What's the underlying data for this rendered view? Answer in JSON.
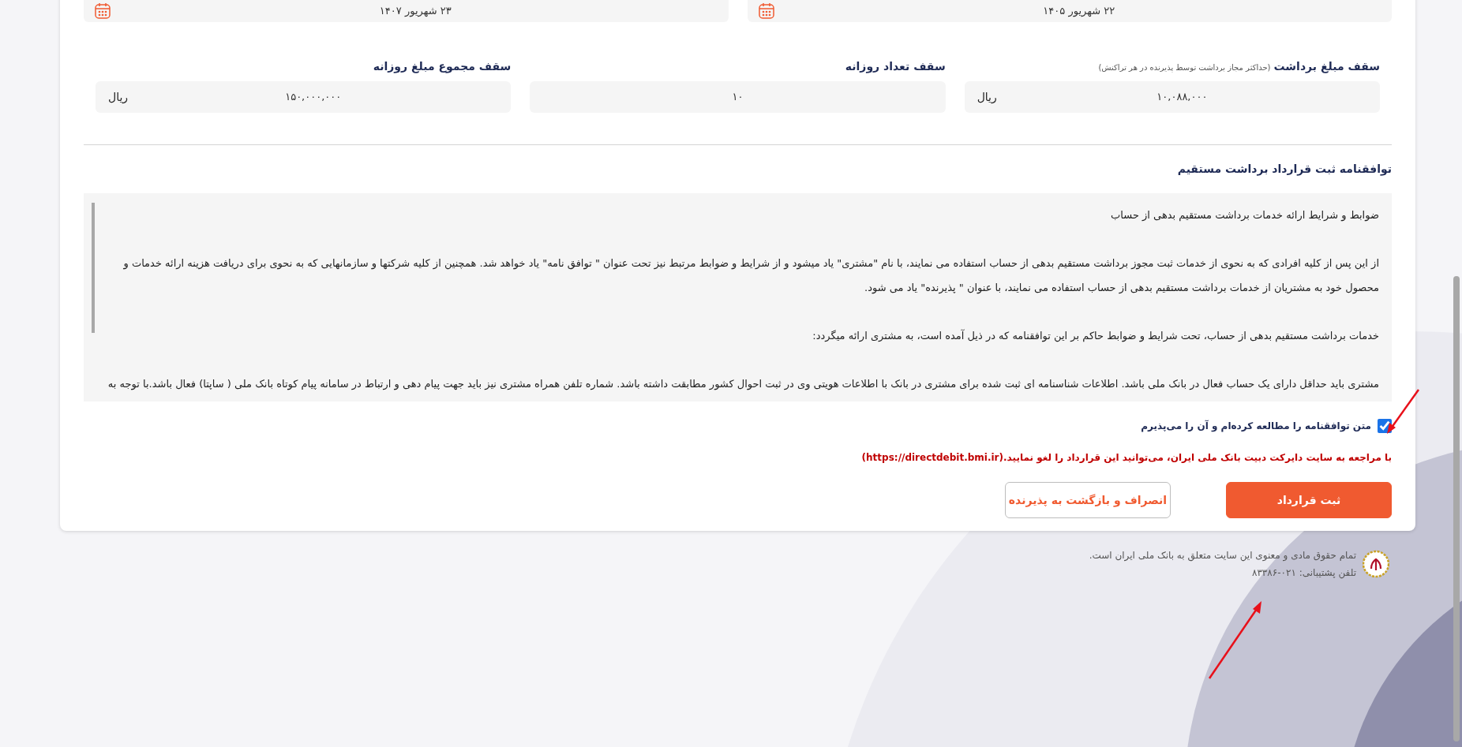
{
  "dates": [
    {
      "value": "۲۲ شهریور ۱۴۰۵"
    },
    {
      "value": "۲۳ شهریور ۱۴۰۷"
    }
  ],
  "limits": [
    {
      "label": "سقف مبلغ برداشت",
      "hint": "(حداکثر مجاز برداشت توسط پذیرنده در هر تراکنش)",
      "value": "۱۰,۰۸۸,۰۰۰",
      "unit": "ریال"
    },
    {
      "label": "سقف تعداد روزانه",
      "value": "۱۰"
    },
    {
      "label": "سقف مجموع مبلغ روزانه",
      "value": "۱۵۰,۰۰۰,۰۰۰",
      "unit": "ریال"
    }
  ],
  "agreement": {
    "title": "توافقنامه ثبت قرارداد برداشت مستقیم",
    "paragraphs": [
      "ضوابط و شرایط ارائه خدمات برداشت مستقیم بدهی از حساب",
      "از این پس از کلیه افرادی که به نحوی از خدمات ثبت مجوز برداشت مستقیم بدهی از حساب استفاده می نمایند، با نام \"مشتری\" یاد میشود و از شرایط و ضوابط مرتبط نیز تحت عنوان \" توافق نامه\" یاد خواهد شد. همچنین از کلیه شرکتها و سازمانهایی که به نحوی برای دریافت هزینه ارائه خدمات و محصول خود به مشتریان از خدمات برداشت مستقیم بدهی از حساب استفاده می نمایند، با عنوان \" پذیرنده\" یاد می شود.",
      "خدمات برداشت مستقیم بدهی از حساب، تحت شرایط و ضوابط حاکم بر این توافقنامه که در ذیل آمده است، به مشتری ارائه میگردد:",
      "مشتری باید حداقل دارای یک حساب فعال در بانک ملی باشد. اطلاعات شناسنامه ای ثبت شده برای مشتری در بانک با اطلاعات هویتی وی در ثبت احوال کشور مطابقت داشته باشد. شماره تلفن همراه مشتری نیز باید جهت پیام دهی و ارتباط در سامانه پیام کوتاه بانک ملی ( ساپتا) فعال باشد.با توجه به"
    ]
  },
  "accept": {
    "label": "متن توافقنامه را مطالعه کرده‌ام و آن را می‌پذیرم",
    "checked": true
  },
  "notice": "با مراجعه به سایت دایرکت دبیت بانک ملی ایران، می‌توانید این قرارداد را لغو نمایید.(https://directdebit.bmi.ir)",
  "buttons": [
    {
      "label": "ثبت قرارداد",
      "kind": "primary"
    },
    {
      "label": "انصراف و بازگشت به پذیرنده",
      "kind": "secondary"
    }
  ],
  "footer": {
    "copyright": "تمام حقوق مادی و معنوی این سایت متعلق به بانک ملی ایران است.",
    "phone": "تلفن پشتیبانی: ۰۲۱-۸۳۳۸۶"
  }
}
